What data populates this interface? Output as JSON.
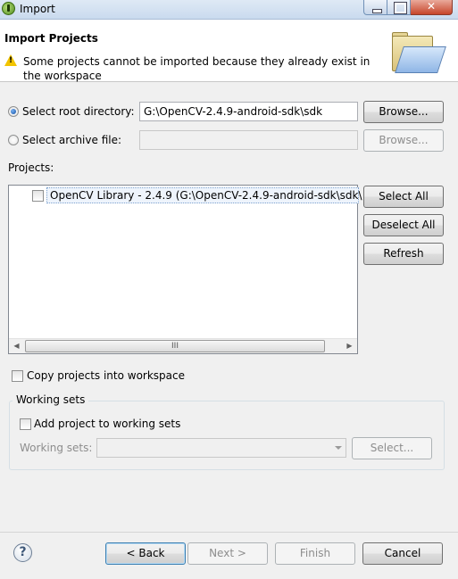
{
  "window": {
    "title": "Import"
  },
  "header": {
    "title": "Import Projects",
    "warning": "Some projects cannot be imported because they already exist in the workspace"
  },
  "source": {
    "root_dir_label": "Select root directory:",
    "root_dir_value": "G:\\OpenCV-2.4.9-android-sdk\\sdk",
    "root_browse_label": "Browse...",
    "archive_label": "Select archive file:",
    "archive_value": "",
    "archive_browse_label": "Browse...",
    "selected": "root_directory"
  },
  "projects": {
    "label": "Projects:",
    "items": [
      {
        "label": "OpenCV Library - 2.4.9 (G:\\OpenCV-2.4.9-android-sdk\\sdk\\",
        "checked": false
      }
    ],
    "scroll_thumb": "III",
    "select_all_label": "Select All",
    "deselect_all_label": "Deselect All",
    "refresh_label": "Refresh"
  },
  "options": {
    "copy_label": "Copy projects into workspace",
    "copy_checked": false
  },
  "working_sets": {
    "group_title": "Working sets",
    "add_label": "Add project to working sets",
    "add_checked": false,
    "sets_label": "Working sets:",
    "sets_value": "",
    "select_label": "Select..."
  },
  "footer": {
    "help_icon": "?",
    "back_label": "< Back",
    "next_label": "Next >",
    "finish_label": "Finish",
    "cancel_label": "Cancel"
  },
  "icons": {
    "app": "eclipse-icon",
    "warning": "warning-icon",
    "wizard": "folder-import-icon",
    "help": "help-icon"
  }
}
